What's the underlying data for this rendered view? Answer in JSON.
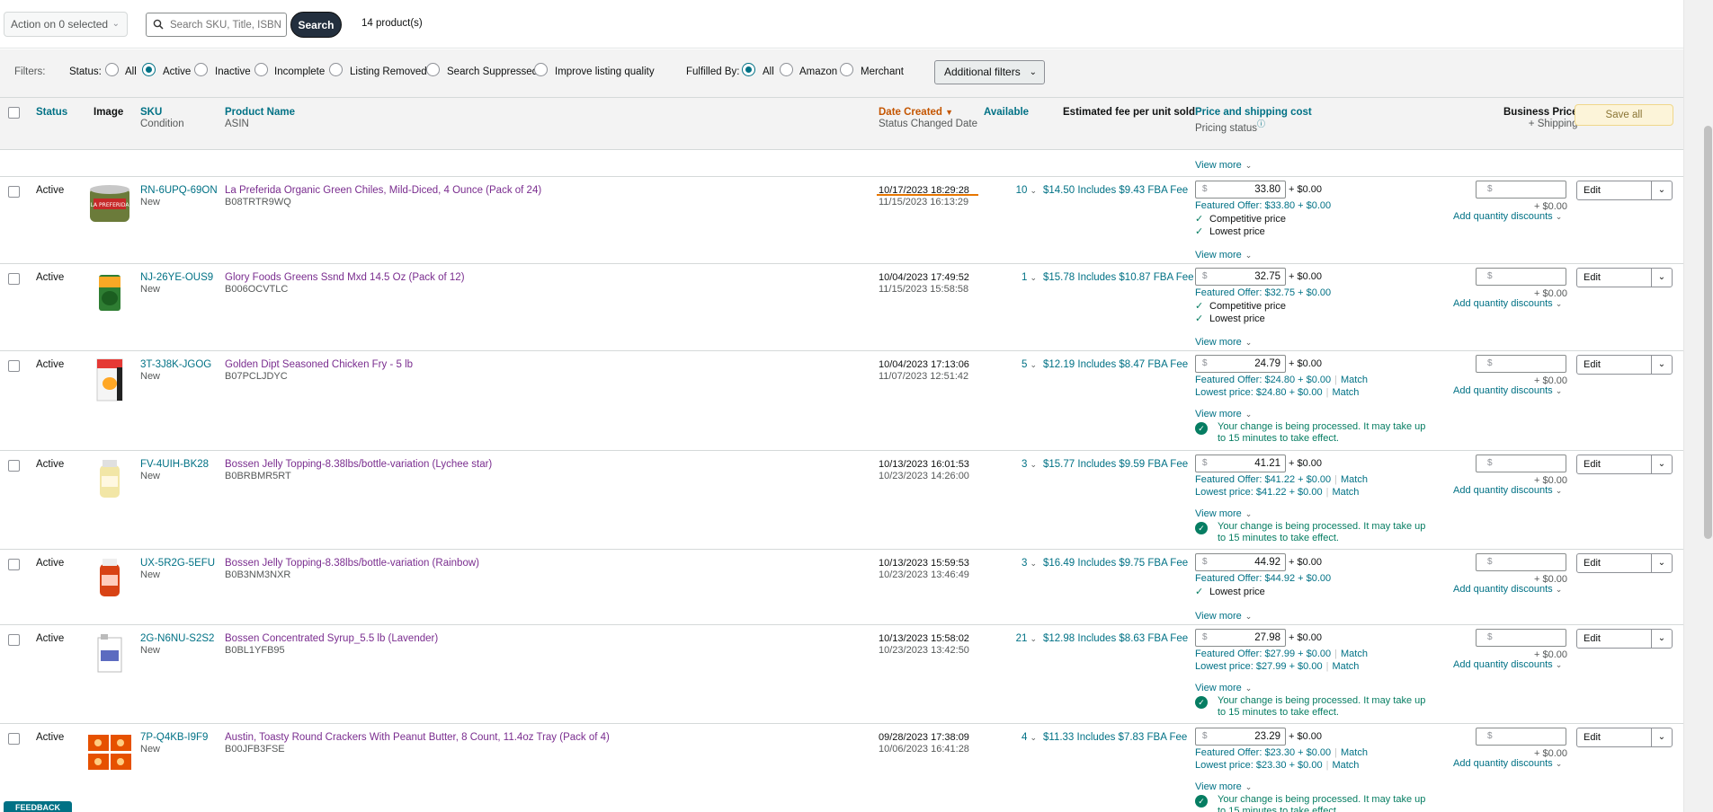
{
  "toolbar": {
    "action_label": "Action on 0 selected",
    "search_placeholder": "Search SKU, Title, ISBN",
    "search_button": "Search",
    "product_count": "14 product(s)"
  },
  "filters": {
    "filters_label": "Filters:",
    "status_label": "Status:",
    "status_options": [
      "All",
      "Active",
      "Inactive",
      "Incomplete",
      "Listing Removed",
      "Search Suppressed",
      "Improve listing quality"
    ],
    "status_selected": "Active",
    "fulfilled_label": "Fulfilled By:",
    "fulfilled_options": [
      "All",
      "Amazon",
      "Merchant"
    ],
    "fulfilled_selected": "All",
    "additional_filters": "Additional filters"
  },
  "columns": {
    "status": "Status",
    "image": "Image",
    "sku": "SKU",
    "condition": "Condition",
    "product_name": "Product Name",
    "asin": "ASIN",
    "date_created": "Date Created",
    "status_changed": "Status Changed Date",
    "available": "Available",
    "fee": "Estimated fee per unit sold",
    "price": "Price and shipping cost",
    "pricing_status": "Pricing status",
    "business_price": "Business Price",
    "business_shipping": "+ Shipping",
    "save_all": "Save all"
  },
  "common": {
    "view_more": "View more",
    "edit": "Edit",
    "add_quantity_discounts": "Add quantity discounts",
    "business_shipping_value": "+ $0.00",
    "shipping_value": "+ $0.00",
    "currency_symbol": "$",
    "match": "Match",
    "processing_notice": "Your change is being processed. It may take up to 15 minutes to take effect.",
    "feedback": "FEEDBACK"
  },
  "rows": [
    {
      "status": "Active",
      "sku": "RN-6UPQ-69ON",
      "condition": "New",
      "name": "La Preferida Organic Green Chiles, Mild-Diced, 4 Ounce (Pack of 24)",
      "asin": "B08TRTR9WQ",
      "created": "10/17/2023 18:29:28",
      "changed": "11/15/2023 16:13:29",
      "available": "10",
      "fee": "$14.50 Includes $9.43 FBA Fee",
      "price": "33.80",
      "featured": "Featured Offer: $33.80 + $0.00",
      "checks": [
        "Competitive price",
        "Lowest price"
      ]
    },
    {
      "status": "Active",
      "sku": "NJ-26YE-OUS9",
      "condition": "New",
      "name": "Glory Foods Greens Ssnd Mxd 14.5 Oz (Pack of 12)",
      "asin": "B006OCVTLC",
      "created": "10/04/2023 17:49:52",
      "changed": "11/15/2023 15:58:58",
      "available": "1",
      "fee": "$15.78 Includes $10.87 FBA Fee",
      "price": "32.75",
      "featured": "Featured Offer: $32.75 + $0.00",
      "checks": [
        "Competitive price",
        "Lowest price"
      ]
    },
    {
      "status": "Active",
      "sku": "3T-3J8K-JGOG",
      "condition": "New",
      "name": "Golden Dipt Seasoned Chicken Fry - 5 lb",
      "asin": "B07PCLJDYC",
      "created": "10/04/2023 17:13:06",
      "changed": "11/07/2023 12:51:42",
      "available": "5",
      "fee": "$12.19 Includes $8.47 FBA Fee",
      "price": "24.79",
      "featured": "Featured Offer: $24.80 + $0.00",
      "lowest": "Lowest price: $24.80 + $0.00"
    },
    {
      "status": "Active",
      "sku": "FV-4UIH-BK28",
      "condition": "New",
      "name": "Bossen Jelly Topping-8.38lbs/bottle-variation (Lychee star)",
      "asin": "B0BRBMR5RT",
      "created": "10/13/2023 16:01:53",
      "changed": "10/23/2023 14:26:00",
      "available": "3",
      "fee": "$15.77 Includes $9.59 FBA Fee",
      "price": "41.21",
      "featured": "Featured Offer: $41.22 + $0.00",
      "lowest": "Lowest price: $41.22 + $0.00"
    },
    {
      "status": "Active",
      "sku": "UX-5R2G-5EFU",
      "condition": "New",
      "name": "Bossen Jelly Topping-8.38lbs/bottle-variation (Rainbow)",
      "asin": "B0B3NM3NXR",
      "created": "10/13/2023 15:59:53",
      "changed": "10/23/2023 13:46:49",
      "available": "3",
      "fee": "$16.49 Includes $9.75 FBA Fee",
      "price": "44.92",
      "featured": "Featured Offer: $44.92 + $0.00",
      "checks": [
        "Lowest price"
      ]
    },
    {
      "status": "Active",
      "sku": "2G-N6NU-S2S2",
      "condition": "New",
      "name": "Bossen Concentrated Syrup_5.5 lb (Lavender)",
      "asin": "B0BL1YFB95",
      "created": "10/13/2023 15:58:02",
      "changed": "10/23/2023 13:42:50",
      "available": "21",
      "fee": "$12.98 Includes $8.63 FBA Fee",
      "price": "27.98",
      "featured": "Featured Offer: $27.99 + $0.00",
      "lowest": "Lowest price: $27.99 + $0.00"
    },
    {
      "status": "Active",
      "sku": "7P-Q4KB-I9F9",
      "condition": "New",
      "name": "Austin, Toasty Round Crackers With Peanut Butter, 8 Count, 11.4oz Tray (Pack of 4)",
      "asin": "B00JFB3FSE",
      "created": "09/28/2023 17:38:09",
      "changed": "10/06/2023 16:41:28",
      "available": "4",
      "fee": "$11.33 Includes $7.83 FBA Fee",
      "price": "23.29",
      "featured": "Featured Offer: $23.30 + $0.00",
      "lowest": "Lowest price: $23.30 + $0.00"
    }
  ]
}
